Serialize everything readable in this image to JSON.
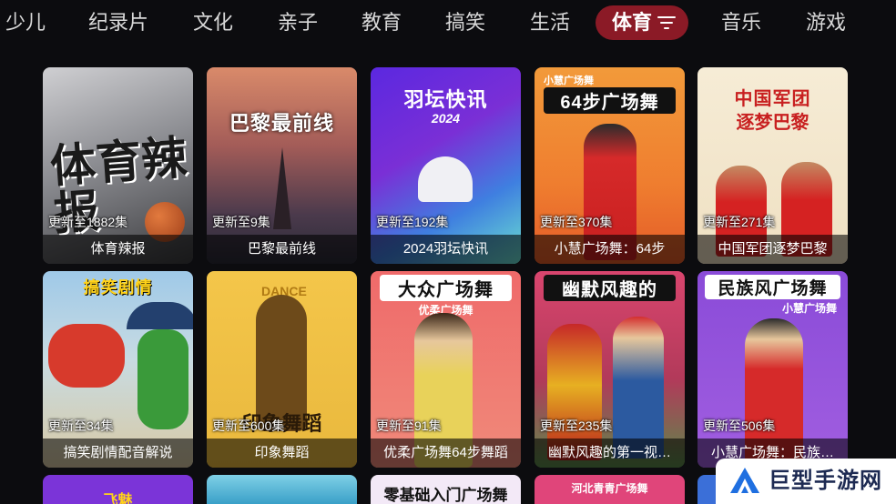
{
  "nav": {
    "items": [
      {
        "label": "少儿"
      },
      {
        "label": "纪录片"
      },
      {
        "label": "文化"
      },
      {
        "label": "亲子"
      },
      {
        "label": "教育"
      },
      {
        "label": "搞笑"
      },
      {
        "label": "生活"
      },
      {
        "label": "体育",
        "active": true,
        "icon": "filter-icon"
      },
      {
        "label": "音乐"
      },
      {
        "label": "游戏"
      }
    ]
  },
  "cards": [
    {
      "title": "体育辣报",
      "episodes": "更新至1882集",
      "poster_text": "体育辣报",
      "poster_sub": ""
    },
    {
      "title": "巴黎最前线",
      "episodes": "更新至9集",
      "poster_text": "巴黎最前线",
      "poster_sub": ""
    },
    {
      "title": "2024羽坛快讯",
      "episodes": "更新至192集",
      "poster_text": "羽坛快讯",
      "poster_sub": "2024"
    },
    {
      "title": "小慧广场舞：64步",
      "episodes": "更新至370集",
      "poster_text": "64步广场舞",
      "poster_sub": "小慧广场舞"
    },
    {
      "title": "中国军团逐梦巴黎",
      "episodes": "更新至271集",
      "poster_text": "中国军团",
      "poster_sub": "逐梦巴黎"
    },
    {
      "title": "搞笑剧情配音解说",
      "episodes": "更新至34集",
      "poster_text": "搞笑剧情",
      "poster_sub": ""
    },
    {
      "title": "印象舞蹈",
      "episodes": "更新至600集",
      "poster_text": "印象舞蹈",
      "poster_sub": "DANCE"
    },
    {
      "title": "优柔广场舞64步舞蹈",
      "episodes": "更新至91集",
      "poster_text": "大众广场舞",
      "poster_sub": "优柔广场舞"
    },
    {
      "title": "幽默风趣的第一视…",
      "episodes": "更新至235集",
      "poster_text": "幽默风趣的",
      "poster_sub": ""
    },
    {
      "title": "小慧广场舞：民族…",
      "episodes": "更新至506集",
      "poster_text": "民族风广场舞",
      "poster_sub": "小慧广场舞"
    }
  ],
  "partial_cards": [
    {
      "poster_text": "飞魅"
    },
    {
      "poster_text": ""
    },
    {
      "poster_text": "零基础入门广场舞"
    },
    {
      "poster_text": "河北青青广场舞"
    },
    {
      "poster_text": ""
    }
  ],
  "watermark": {
    "text": "巨型手游网",
    "icon": "logo-icon"
  },
  "colors": {
    "background": "#0c0c0f",
    "active_tab": "#8b1a26",
    "caption_bg": "rgba(0,0,0,0.58)"
  }
}
